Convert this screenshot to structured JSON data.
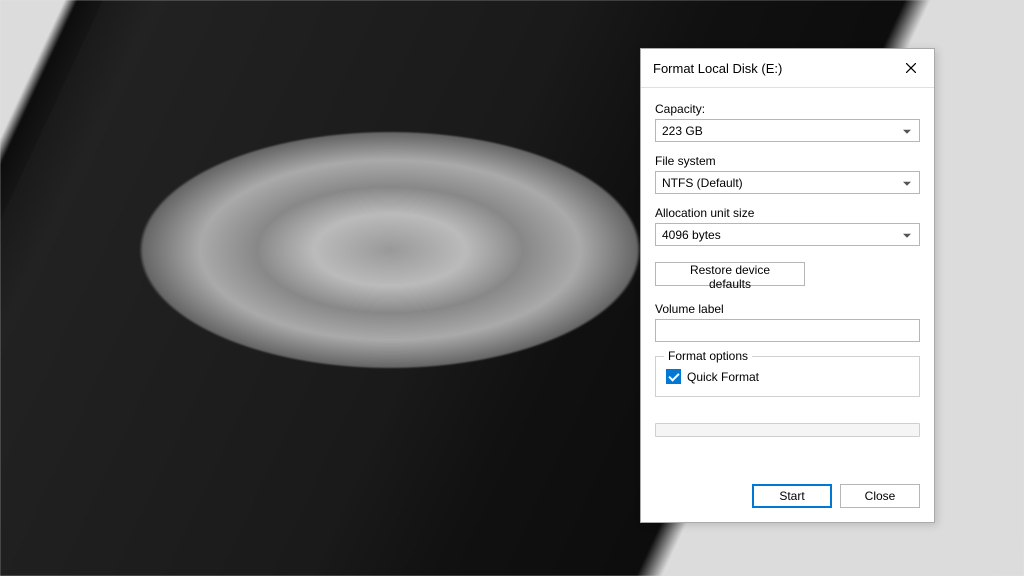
{
  "dialog": {
    "title": "Format Local Disk (E:)",
    "capacity": {
      "label": "Capacity:",
      "value": "223 GB"
    },
    "filesystem": {
      "label": "File system",
      "value": "NTFS (Default)"
    },
    "allocation": {
      "label": "Allocation unit size",
      "value": "4096 bytes"
    },
    "restore_label": "Restore device defaults",
    "volume_label": {
      "label": "Volume label",
      "value": ""
    },
    "format_options": {
      "legend": "Format options",
      "quick_format_label": "Quick Format",
      "quick_format_checked": true
    },
    "buttons": {
      "start": "Start",
      "close": "Close"
    }
  }
}
